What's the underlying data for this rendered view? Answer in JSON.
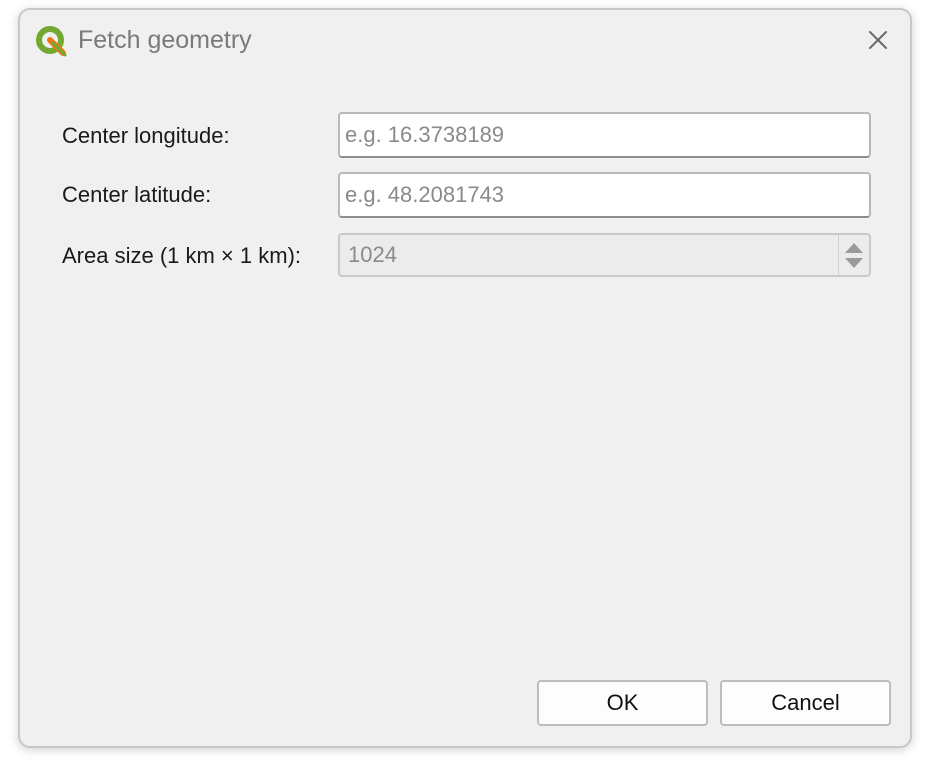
{
  "window": {
    "title": "Fetch geometry",
    "app_icon": "qgis-logo-icon",
    "close_icon": "close-icon"
  },
  "form": {
    "longitude": {
      "label": "Center longitude:",
      "value": "",
      "placeholder": "e.g. 16.3738189"
    },
    "latitude": {
      "label": "Center latitude:",
      "value": "",
      "placeholder": "e.g. 48.2081743"
    },
    "area_size": {
      "label": "Area size (1 km × 1 km):",
      "value": "1024",
      "enabled": false,
      "up_icon": "spin-up-icon",
      "down_icon": "spin-down-icon"
    }
  },
  "buttons": {
    "ok_label": "OK",
    "cancel_label": "Cancel"
  },
  "colors": {
    "accent_green": "#73a833",
    "window_bg": "#f0f0f0"
  }
}
